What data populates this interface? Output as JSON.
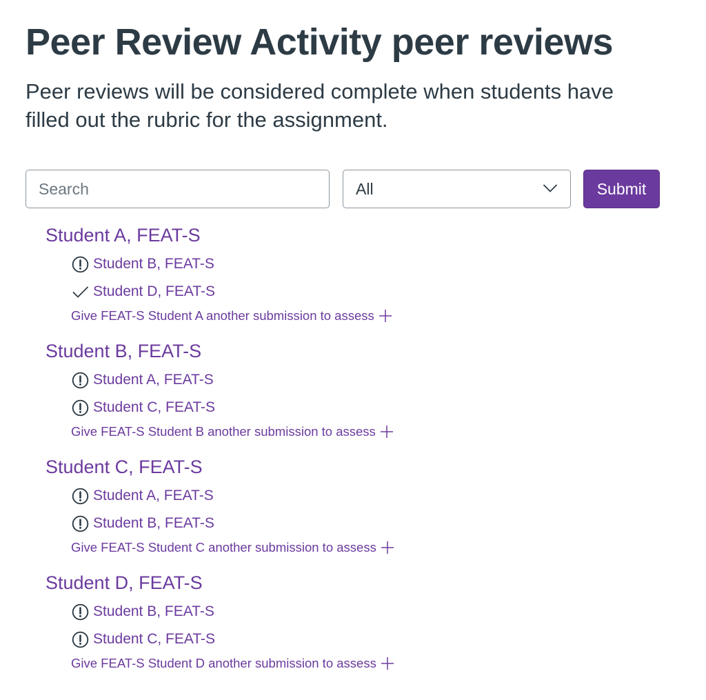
{
  "header": {
    "title": "Peer Review Activity peer reviews",
    "description": "Peer reviews will be considered complete when students have filled out the rubric for the assignment."
  },
  "filters": {
    "search_placeholder": "Search",
    "select_value": "All",
    "submit_label": "Submit"
  },
  "colors": {
    "accent": "#6b3a9e",
    "text": "#2d3b45",
    "border": "#8b969e"
  },
  "students": [
    {
      "name": "Student A, FEAT-S",
      "assessors": [
        {
          "name": "Student B, FEAT-S",
          "status": "incomplete",
          "icon": "warning-circle-icon"
        },
        {
          "name": "Student D, FEAT-S",
          "status": "complete",
          "icon": "checkmark-icon"
        }
      ],
      "assign_label": "Give FEAT-S Student A another submission to assess"
    },
    {
      "name": "Student B, FEAT-S",
      "assessors": [
        {
          "name": "Student A, FEAT-S",
          "status": "incomplete",
          "icon": "warning-circle-icon"
        },
        {
          "name": "Student C, FEAT-S",
          "status": "incomplete",
          "icon": "warning-circle-icon"
        }
      ],
      "assign_label": "Give FEAT-S Student B another submission to assess"
    },
    {
      "name": "Student C, FEAT-S",
      "assessors": [
        {
          "name": "Student A, FEAT-S",
          "status": "incomplete",
          "icon": "warning-circle-icon"
        },
        {
          "name": "Student B, FEAT-S",
          "status": "incomplete",
          "icon": "warning-circle-icon"
        }
      ],
      "assign_label": "Give FEAT-S Student C another submission to assess"
    },
    {
      "name": "Student D, FEAT-S",
      "assessors": [
        {
          "name": "Student B, FEAT-S",
          "status": "incomplete",
          "icon": "warning-circle-icon"
        },
        {
          "name": "Student C, FEAT-S",
          "status": "incomplete",
          "icon": "warning-circle-icon"
        }
      ],
      "assign_label": "Give FEAT-S Student D another submission to assess"
    }
  ]
}
